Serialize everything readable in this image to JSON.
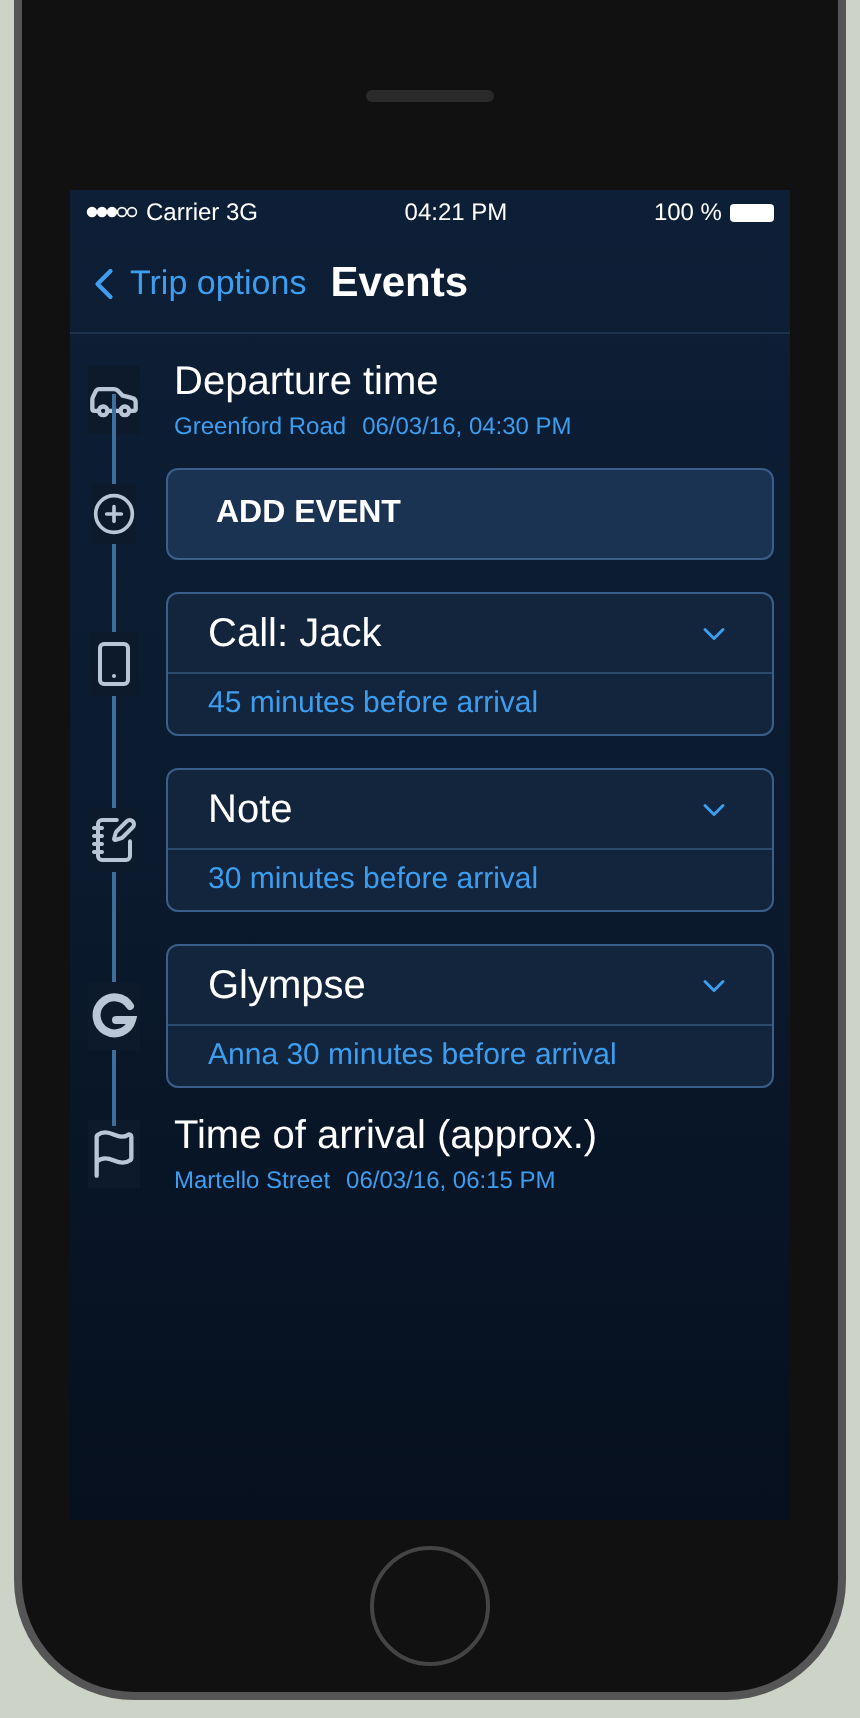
{
  "status_bar": {
    "carrier": "Carrier 3G",
    "time": "04:21 PM",
    "battery": "100 %"
  },
  "nav": {
    "back": "Trip options",
    "title": "Events"
  },
  "timeline": [
    {
      "kind": "endpoint",
      "title": "Departure time",
      "place": "Greenford Road",
      "datetime": "06/03/16, 04:30 PM"
    },
    {
      "kind": "add",
      "title": "ADD EVENT"
    },
    {
      "kind": "event",
      "title": "Call: Jack",
      "detail": "45 minutes before arrival"
    },
    {
      "kind": "event",
      "title": "Note",
      "detail": "30 minutes before arrival"
    },
    {
      "kind": "event",
      "title": "Glympse",
      "detail": "Anna 30 minutes before arrival"
    },
    {
      "kind": "endpoint",
      "title": "Time of arrival (approx.)",
      "place": "Martello Street",
      "datetime": "06/03/16, 06:15 PM"
    }
  ]
}
